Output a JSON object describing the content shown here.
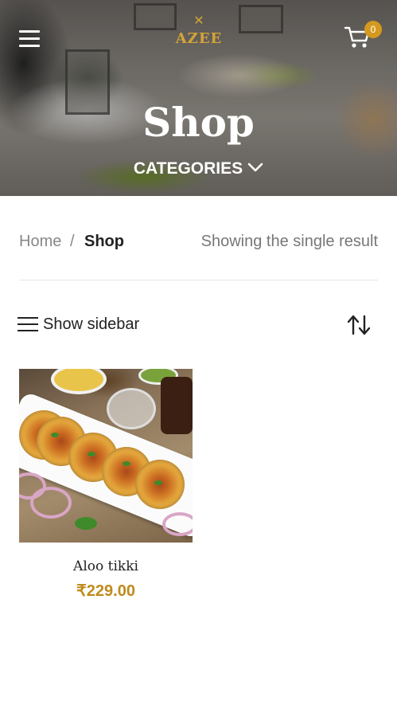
{
  "header": {
    "logo_text": "AZEE",
    "logo_mark": "✕",
    "cart_count": "0",
    "page_title": "Shop",
    "categories_label": "CATEGORIES"
  },
  "breadcrumb": {
    "home": "Home",
    "separator": "/",
    "current": "Shop"
  },
  "result_count": "Showing the single result",
  "toolbar": {
    "show_sidebar_label": "Show sidebar"
  },
  "products": [
    {
      "name": "Aloo tikki",
      "price": "₹229.00"
    }
  ],
  "colors": {
    "accent": "#d49a1f",
    "price": "#c08a1c"
  }
}
